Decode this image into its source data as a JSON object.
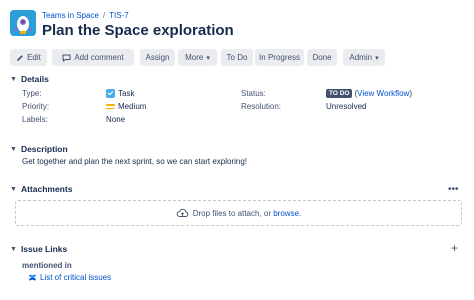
{
  "breadcrumb": {
    "project": "Teams in Space",
    "separator": "/",
    "issue_key": "TIS-7"
  },
  "issue": {
    "title": "Plan the Space exploration"
  },
  "toolbar": {
    "edit": "Edit",
    "add_comment": "Add comment",
    "assign": "Assign",
    "more": "More",
    "to_do": "To Do",
    "in_progress": "In Progress",
    "done": "Done",
    "admin": "Admin"
  },
  "details": {
    "heading": "Details",
    "type_label": "Type:",
    "type_value": "Task",
    "priority_label": "Priority:",
    "priority_value": "Medium",
    "labels_label": "Labels:",
    "labels_value": "None",
    "status_label": "Status:",
    "status_badge": "TO DO",
    "status_open": "(",
    "status_link": "View Workflow",
    "status_close": ")",
    "resolution_label": "Resolution:",
    "resolution_value": "Unresolved"
  },
  "description": {
    "heading": "Description",
    "text": "Get together and plan the next sprint, so we can start exploring!"
  },
  "attachments": {
    "heading": "Attachments",
    "more": "•••",
    "drop_text": "Drop files to attach, or",
    "browse": "browse."
  },
  "issue_links": {
    "heading": "Issue Links",
    "add": "+",
    "relation": "mentioned in",
    "link_text": "List of critical issues"
  },
  "icons": {
    "avatar": "rocket-avatar",
    "edit": "pencil-icon",
    "comment": "speech-bubble-icon",
    "type": "task-checkbox-icon",
    "priority": "medium-priority-icon",
    "upload": "cloud-upload-icon",
    "link": "confluence-icon"
  },
  "colors": {
    "link": "#0052cc",
    "task_icon": "#4bade8",
    "priority": "#ffab00",
    "todo_badge": "#42526e",
    "button_bg": "#ebecf0",
    "avatar_bg": "#2d9fd8"
  }
}
